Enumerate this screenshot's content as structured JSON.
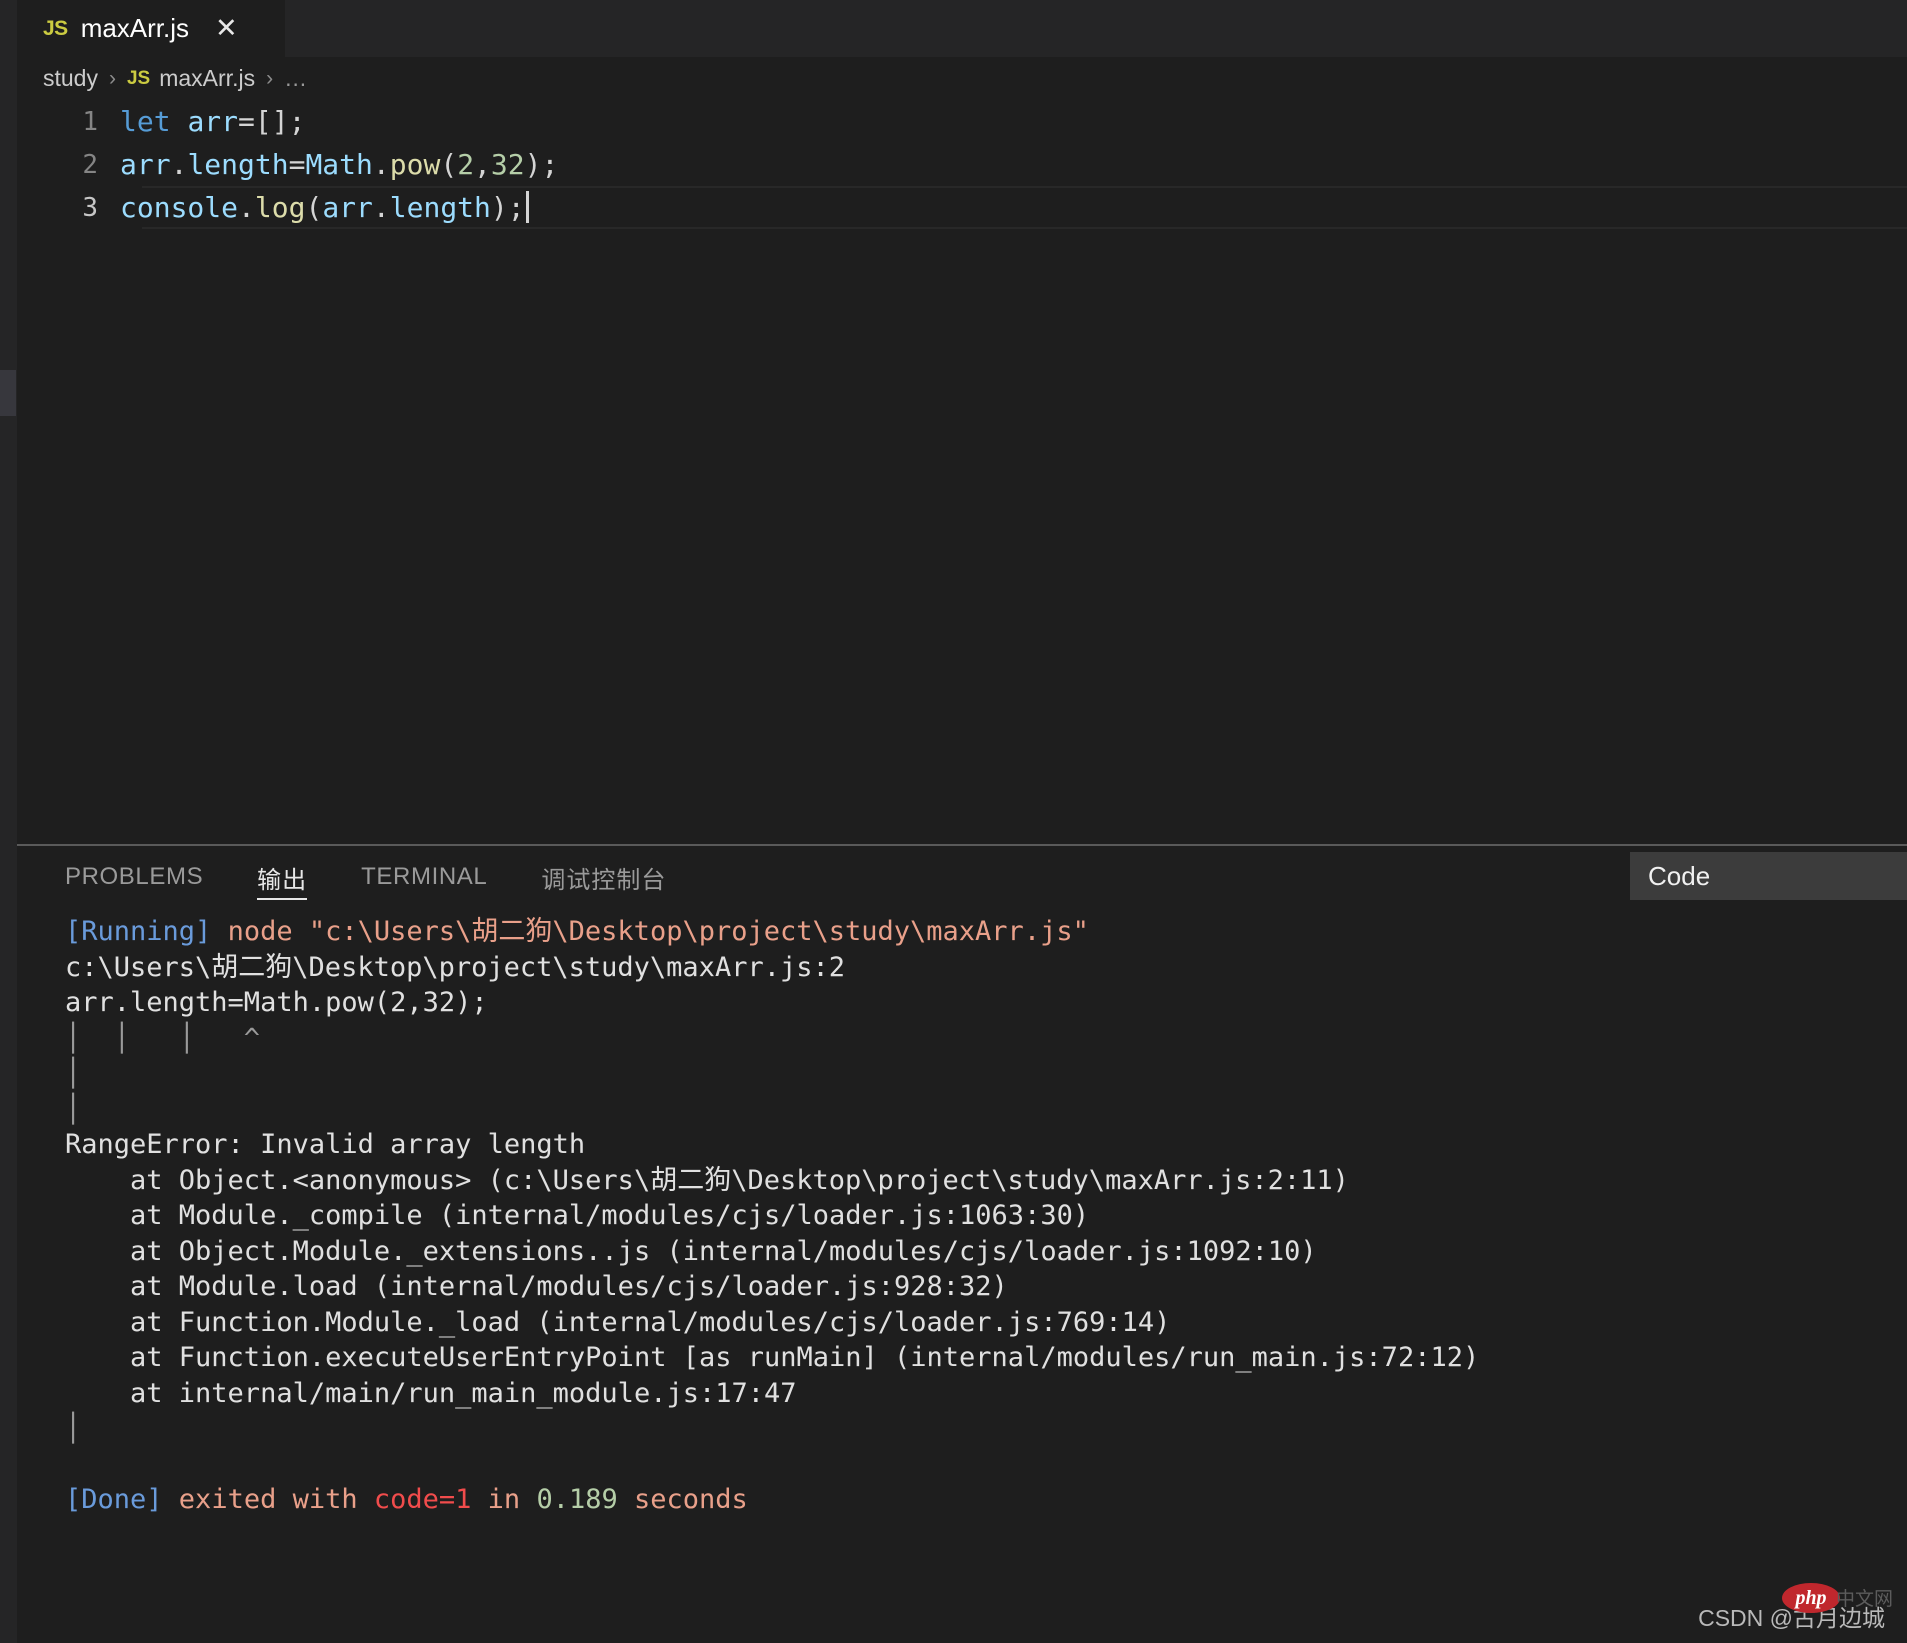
{
  "window": {
    "tab": {
      "icon": "js-file-icon",
      "icon_label": "JS",
      "title": "maxArr.js",
      "close_label": "✕"
    }
  },
  "breadcrumb": {
    "folder": "study",
    "sep": "›",
    "file_icon_label": "JS",
    "file": "maxArr.js",
    "overflow": "…"
  },
  "editor": {
    "lines": [
      {
        "number": "1",
        "text": "let arr=[];",
        "tokens": [
          {
            "t": "let",
            "c": "tk-kw"
          },
          {
            "t": " ",
            "c": "tk-op"
          },
          {
            "t": "arr",
            "c": "tk-var"
          },
          {
            "t": "=[];",
            "c": "tk-punc"
          }
        ]
      },
      {
        "number": "2",
        "text": "arr.length=Math.pow(2,32);",
        "tokens": [
          {
            "t": "arr",
            "c": "tk-var"
          },
          {
            "t": ".",
            "c": "tk-punc"
          },
          {
            "t": "length",
            "c": "tk-prop"
          },
          {
            "t": "=",
            "c": "tk-punc"
          },
          {
            "t": "Math",
            "c": "tk-var"
          },
          {
            "t": ".",
            "c": "tk-punc"
          },
          {
            "t": "pow",
            "c": "tk-fn"
          },
          {
            "t": "(",
            "c": "tk-punc"
          },
          {
            "t": "2",
            "c": "tk-num"
          },
          {
            "t": ",",
            "c": "tk-punc"
          },
          {
            "t": "32",
            "c": "tk-num"
          },
          {
            "t": ");",
            "c": "tk-punc"
          }
        ]
      },
      {
        "number": "3",
        "text": "console.log(arr.length);",
        "active": true,
        "tokens": [
          {
            "t": "console",
            "c": "tk-var"
          },
          {
            "t": ".",
            "c": "tk-punc"
          },
          {
            "t": "log",
            "c": "tk-fn"
          },
          {
            "t": "(",
            "c": "tk-punc"
          },
          {
            "t": "arr",
            "c": "tk-var"
          },
          {
            "t": ".",
            "c": "tk-punc"
          },
          {
            "t": "length",
            "c": "tk-prop"
          },
          {
            "t": ");",
            "c": "tk-punc"
          }
        ]
      }
    ]
  },
  "panel": {
    "tabs": [
      {
        "label": "PROBLEMS",
        "active": false,
        "cjk": false
      },
      {
        "label": "输出",
        "active": true,
        "cjk": true
      },
      {
        "label": "TERMINAL",
        "active": false,
        "cjk": false
      },
      {
        "label": "调试控制台",
        "active": false,
        "cjk": true
      }
    ],
    "channel_select": {
      "value": "Code"
    },
    "output_lines": [
      {
        "id": "running",
        "segments": [
          {
            "t": "[Running]",
            "c": "c-blue"
          },
          {
            "t": " ",
            "c": "c-salmon"
          },
          {
            "t": "node \"c:\\Users\\胡二狗\\Desktop\\project\\study\\maxArr.js\"",
            "c": "c-salmon"
          }
        ]
      },
      {
        "id": "error-path",
        "segments": [
          {
            "t": "c:\\Users\\胡二狗\\Desktop\\project\\study\\maxArr.js:2",
            "c": "c-white"
          }
        ]
      },
      {
        "id": "error-source",
        "segments": [
          {
            "t": "arr.length=Math.pow(2,32);",
            "c": "c-white"
          }
        ]
      },
      {
        "id": "error-caret",
        "segments": [
          {
            "t": "│  │   │   ^",
            "c": "c-gray"
          }
        ]
      },
      {
        "id": "blank-1",
        "segments": [
          {
            "t": "│",
            "c": "c-gray"
          }
        ]
      },
      {
        "id": "blank-2",
        "segments": [
          {
            "t": "│",
            "c": "c-gray"
          }
        ]
      },
      {
        "id": "range-error",
        "segments": [
          {
            "t": "RangeError: Invalid array length",
            "c": "c-white"
          }
        ]
      },
      {
        "id": "stack-1",
        "segments": [
          {
            "t": "    at Object.<anonymous> (c:\\Users\\胡二狗\\Desktop\\project\\study\\maxArr.js:2:11)",
            "c": "c-white"
          }
        ]
      },
      {
        "id": "stack-2",
        "segments": [
          {
            "t": "    at Module._compile (internal/modules/cjs/loader.js:1063:30)",
            "c": "c-white"
          }
        ]
      },
      {
        "id": "stack-3",
        "segments": [
          {
            "t": "    at Object.Module._extensions..js (internal/modules/cjs/loader.js:1092:10)",
            "c": "c-white"
          }
        ]
      },
      {
        "id": "stack-4",
        "segments": [
          {
            "t": "    at Module.load (internal/modules/cjs/loader.js:928:32)",
            "c": "c-white"
          }
        ]
      },
      {
        "id": "stack-5",
        "segments": [
          {
            "t": "    at Function.Module._load (internal/modules/cjs/loader.js:769:14)",
            "c": "c-white"
          }
        ]
      },
      {
        "id": "stack-6",
        "segments": [
          {
            "t": "    at Function.executeUserEntryPoint [as runMain] (internal/modules/run_main.js:72:12)",
            "c": "c-white"
          }
        ]
      },
      {
        "id": "stack-7",
        "segments": [
          {
            "t": "    at internal/main/run_main_module.js:17:47",
            "c": "c-white"
          }
        ]
      },
      {
        "id": "blank-3",
        "segments": [
          {
            "t": "│",
            "c": "c-gray"
          }
        ]
      },
      {
        "id": "blank-4",
        "segments": [
          {
            "t": "",
            "c": "c-white"
          }
        ]
      },
      {
        "id": "done",
        "segments": [
          {
            "t": "[Done]",
            "c": "c-blue"
          },
          {
            "t": " exited with ",
            "c": "c-salmon"
          },
          {
            "t": "code=1",
            "c": "c-red"
          },
          {
            "t": " in ",
            "c": "c-salmon"
          },
          {
            "t": "0.189",
            "c": "c-green"
          },
          {
            "t": " seconds",
            "c": "c-salmon"
          }
        ]
      }
    ]
  },
  "watermark": {
    "text": "CSDN @古月边城",
    "logo": "php",
    "logo_suffix": "中文网"
  },
  "colors": {
    "editor_bg": "#1e1e1e",
    "chrome_bg": "#252526",
    "accent_js": "#cbcb41",
    "error_red": "#f14c4c",
    "number_green": "#b5cea8",
    "path_salmon": "#e9a08a",
    "tag_blue": "#6a9bdb"
  }
}
